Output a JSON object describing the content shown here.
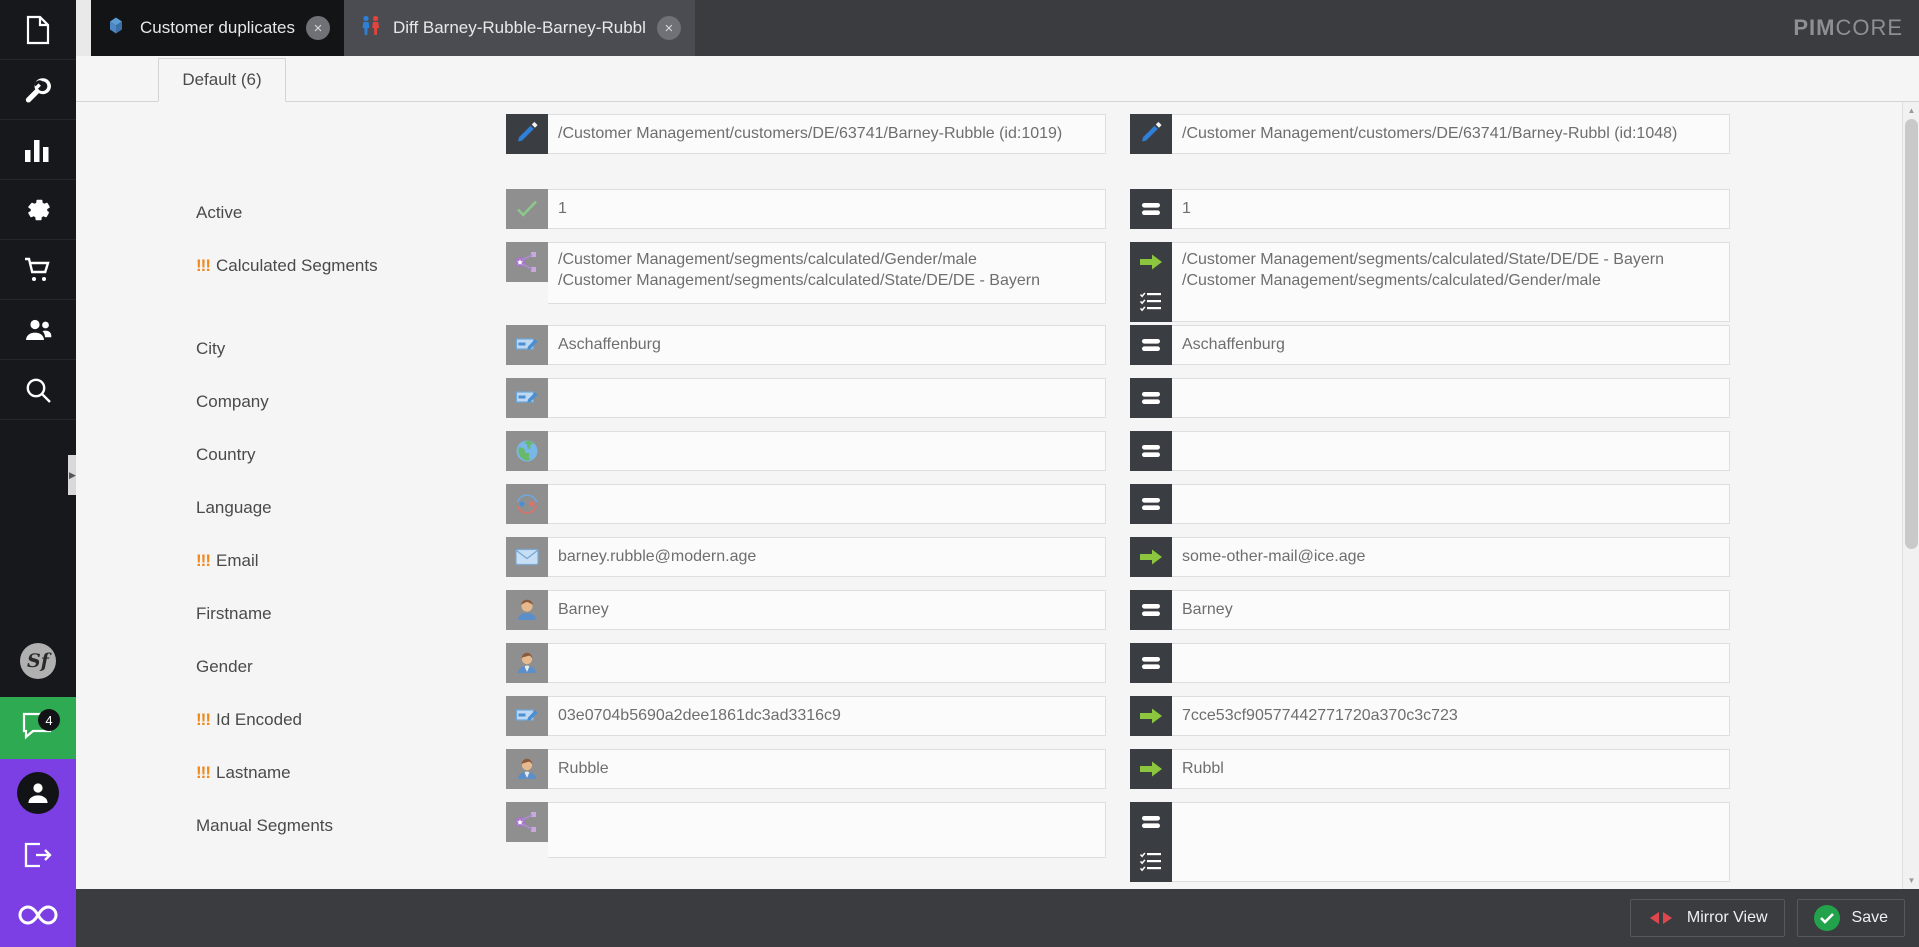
{
  "app": {
    "brand_main": "PIM",
    "brand_rest": "CORE"
  },
  "sidebar": {
    "items": [
      {
        "name": "file-icon",
        "label": "File"
      },
      {
        "name": "wrench-icon",
        "label": "Tools"
      },
      {
        "name": "bar-chart-icon",
        "label": "Reports"
      },
      {
        "name": "gear-icon",
        "label": "Settings"
      },
      {
        "name": "shopping-cart-icon",
        "label": "Ecommerce"
      },
      {
        "name": "users-icon",
        "label": "Customers"
      },
      {
        "name": "search-icon",
        "label": "Search"
      }
    ],
    "symfony_label": "Sf",
    "chat_badge": "4",
    "user_label": "User",
    "logout_label": "Logout",
    "infinity_label": "Infinity"
  },
  "tabs": [
    {
      "label": "Customer duplicates",
      "icon": "layers-icon",
      "active": false,
      "close": "×"
    },
    {
      "label": "Diff Barney-Rubble-Barney-Rubbl",
      "icon": "people-pair-icon",
      "active": true,
      "close": "×"
    }
  ],
  "subtabs": [
    {
      "label": "Default (6)",
      "active": true
    }
  ],
  "diff": {
    "header": {
      "label": "",
      "left": {
        "icon": "pencil-icon",
        "value": "/Customer Management/customers/DE/63741/Barney-Rubble (id:1019)"
      },
      "right": {
        "icon": "pencil-icon",
        "value": "/Customer Management/customers/DE/63741/Barney-Rubbl (id:1048)"
      }
    },
    "rows": [
      {
        "label": "Active",
        "changed": false,
        "left": {
          "icon": "check-icon",
          "icon_style": "grey",
          "value": "1",
          "lines": null
        },
        "right": {
          "icon": "equals-icon",
          "icon_style": "dark",
          "value": "1",
          "lines": null
        }
      },
      {
        "label": "Calculated Segments",
        "changed": true,
        "left": {
          "icon": "share-nodes-icon",
          "icon_style": "grey",
          "value": null,
          "lines": [
            "/Customer Management/segments/calculated/Gender/male",
            "/Customer Management/segments/calculated/State/DE/DE - Bayern"
          ],
          "extra_icon": null
        },
        "right": {
          "icon": "green-arrow-icon",
          "icon_style": "dark",
          "value": null,
          "lines": [
            "/Customer Management/segments/calculated/State/DE/DE - Bayern",
            "/Customer Management/segments/calculated/Gender/male"
          ],
          "extra_icon": "checklist-icon"
        }
      },
      {
        "label": "City",
        "changed": false,
        "left": {
          "icon": "text-input-icon",
          "icon_style": "grey",
          "value": "Aschaffenburg",
          "lines": null
        },
        "right": {
          "icon": "equals-icon",
          "icon_style": "dark",
          "value": "Aschaffenburg",
          "lines": null
        }
      },
      {
        "label": "Company",
        "changed": false,
        "left": {
          "icon": "text-input-icon",
          "icon_style": "grey",
          "value": "",
          "lines": null
        },
        "right": {
          "icon": "equals-icon",
          "icon_style": "dark",
          "value": "",
          "lines": null
        }
      },
      {
        "label": "Country",
        "changed": false,
        "left": {
          "icon": "globe-icon",
          "icon_style": "grey",
          "value": "",
          "lines": null
        },
        "right": {
          "icon": "equals-icon",
          "icon_style": "dark",
          "value": "",
          "lines": null
        }
      },
      {
        "label": "Language",
        "changed": false,
        "left": {
          "icon": "language-icon",
          "icon_style": "grey",
          "value": "",
          "lines": null
        },
        "right": {
          "icon": "equals-icon",
          "icon_style": "dark",
          "value": "",
          "lines": null
        }
      },
      {
        "label": "Email",
        "changed": true,
        "left": {
          "icon": "envelope-icon",
          "icon_style": "grey",
          "value": "barney.rubble@modern.age",
          "lines": null
        },
        "right": {
          "icon": "green-arrow-icon",
          "icon_style": "dark",
          "value": "some-other-mail@ice.age",
          "lines": null
        }
      },
      {
        "label": "Firstname",
        "changed": false,
        "left": {
          "icon": "person-female-icon",
          "icon_style": "grey",
          "value": "Barney",
          "lines": null
        },
        "right": {
          "icon": "equals-icon",
          "icon_style": "dark",
          "value": "Barney",
          "lines": null
        }
      },
      {
        "label": "Gender",
        "changed": false,
        "left": {
          "icon": "person-male-icon",
          "icon_style": "grey",
          "value": "",
          "lines": null
        },
        "right": {
          "icon": "equals-icon",
          "icon_style": "dark",
          "value": "",
          "lines": null
        }
      },
      {
        "label": "Id Encoded",
        "changed": true,
        "left": {
          "icon": "text-input-icon",
          "icon_style": "grey",
          "value": "03e0704b5690a2dee1861dc3ad3316c9",
          "lines": null
        },
        "right": {
          "icon": "green-arrow-icon",
          "icon_style": "dark",
          "value": "7cce53cf90577442771720a370c3c723",
          "lines": null
        }
      },
      {
        "label": "Lastname",
        "changed": true,
        "left": {
          "icon": "person-male-icon",
          "icon_style": "grey",
          "value": "Rubble",
          "lines": null
        },
        "right": {
          "icon": "green-arrow-icon",
          "icon_style": "dark",
          "value": "Rubbl",
          "lines": null
        }
      },
      {
        "label": "Manual Segments",
        "changed": false,
        "left": {
          "icon": "share-nodes-icon",
          "icon_style": "grey",
          "value": "",
          "lines": null,
          "extra_icon": null
        },
        "right": {
          "icon": "equals-icon",
          "icon_style": "dark",
          "value": "",
          "lines": null,
          "extra_icon": "checklist-icon"
        }
      }
    ]
  },
  "toolbar": {
    "mirror_label": "Mirror View",
    "save_label": "Save"
  },
  "colors": {
    "accent_orange": "#f08a1e",
    "accent_green": "#8cc63e",
    "save_green": "#22a24a",
    "mirror_red": "#e0474c",
    "sidebar_bg": "#16181c",
    "tabbar_bg": "#3a3c40",
    "purple": "#7b3fe4",
    "chat_green": "#2eaa52"
  },
  "scroll": {
    "up_arrow": "▲",
    "down_arrow": "▼"
  }
}
